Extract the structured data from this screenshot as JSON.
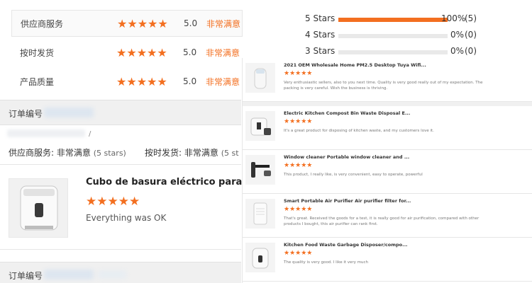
{
  "ratings": [
    {
      "label": "供应商服务",
      "stars": "★★★★★",
      "score": "5.0",
      "text": "非常满意"
    },
    {
      "label": "按时发货",
      "stars": "★★★★★",
      "score": "5.0",
      "text": "非常满意"
    },
    {
      "label": "产品质量",
      "stars": "★★★★★",
      "score": "5.0",
      "text": "非常满意"
    }
  ],
  "order": {
    "label": "订单编号",
    "slash": "/"
  },
  "service_summary": {
    "supplier_label": "供应商服务:",
    "supplier_value": "非常满意",
    "supplier_count": "(5 stars)",
    "delivery_label": "按时发货:",
    "delivery_value": "非常满意",
    "delivery_count": "(5 st"
  },
  "review": {
    "title": "Cubo de basura eléctrico para cocina",
    "stars": "★★★★★",
    "text": "Everything was OK"
  },
  "distribution": [
    {
      "label": "5 Stars",
      "percent": "100%",
      "count": "(5)",
      "fill": 1.0
    },
    {
      "label": "4 Stars",
      "percent": "0%",
      "count": "(0)",
      "fill": 0
    },
    {
      "label": "3 Stars",
      "percent": "0%",
      "count": "(0)",
      "fill": 0
    }
  ],
  "product_reviews": [
    {
      "title": "2021 OEM Wholesale Home PM2.5 Desktop Tuya Wifi...",
      "stars": "★★★★★",
      "review": "Very enthusiastic sellers, also to you next time. Quality is very good really out of my expectation. The packing is very careful. Wish the business is thriving.",
      "icon": "air-purifier-icon"
    },
    {
      "title": "Electric Kitchen Compost Bin Waste Disposal E...",
      "stars": "★★★★★",
      "review": "It's a great product for disposing of kitchen waste, and my customers love it.",
      "icon": "compost-bin-icon"
    },
    {
      "title": "Window cleaner Portable window cleaner and ...",
      "stars": "★★★★★",
      "review": "This product, I really like, is very convenient, easy to operate, powerful",
      "icon": "window-cleaner-icon"
    },
    {
      "title": "Smart Portable Air Purifier Air purifier filter for...",
      "stars": "★★★★★",
      "review": "That's great. Received the goods for a test, it is really good for air purification, compared with other products I bought, this air purifier can rank first.",
      "icon": "air-purifier-icon"
    },
    {
      "title": "Kitchen Food Waste Garbage Disposer/compo...",
      "stars": "★★★★★",
      "review": "The quality is very good. I like it very much",
      "icon": "food-disposer-icon"
    }
  ],
  "colors": {
    "accent": "#f36f20",
    "bar_bg": "#f0f0f0"
  }
}
